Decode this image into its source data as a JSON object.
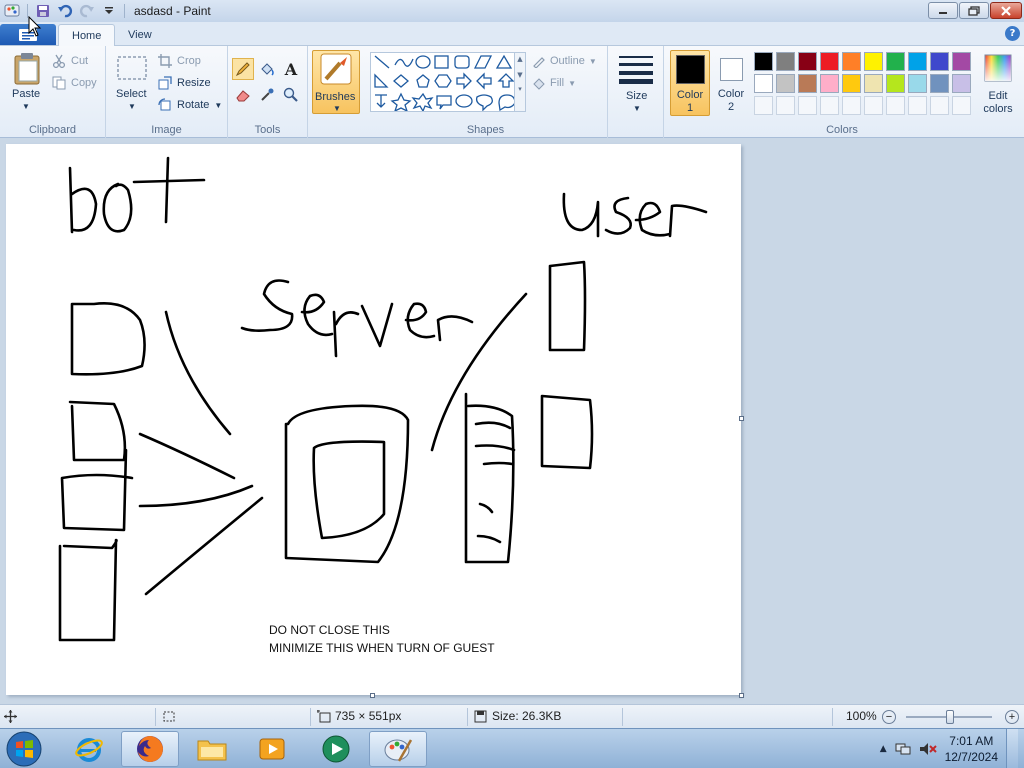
{
  "window": {
    "title": "asdasd - Paint"
  },
  "tabs": [
    {
      "label": "Home"
    },
    {
      "label": "View"
    }
  ],
  "ribbon": {
    "clipboard": {
      "group_label": "Clipboard",
      "paste": "Paste",
      "cut": "Cut",
      "copy": "Copy"
    },
    "image": {
      "group_label": "Image",
      "select": "Select",
      "crop": "Crop",
      "resize": "Resize",
      "rotate": "Rotate"
    },
    "tools": {
      "group_label": "Tools"
    },
    "brushes": {
      "label": "Brushes"
    },
    "shapes": {
      "group_label": "Shapes",
      "outline": "Outline",
      "fill": "Fill"
    },
    "size": {
      "label": "Size"
    },
    "color1": {
      "label_line1": "Color",
      "label_line2": "1"
    },
    "color2": {
      "label_line1": "Color",
      "label_line2": "2"
    },
    "colors": {
      "group_label": "Colors",
      "edit_line1": "Edit",
      "edit_line2": "colors",
      "palette_row1": [
        "#000000",
        "#7f7f7f",
        "#880015",
        "#ed1c24",
        "#ff7f27",
        "#fff200",
        "#22b14c",
        "#00a2e8",
        "#3f48cc",
        "#a349a4"
      ],
      "palette_row2": [
        "#ffffff",
        "#c3c3c3",
        "#b97a57",
        "#ffaec9",
        "#ffc90e",
        "#efe4b0",
        "#b5e61d",
        "#99d9ea",
        "#7092be",
        "#c8bfe7"
      ]
    }
  },
  "canvas": {
    "note_line1": "DO NOT CLOSE THIS",
    "note_line2": "MINIMIZE THIS WHEN TURN OF GUEST"
  },
  "statusbar": {
    "dimensions": "735 × 551px",
    "size": "Size: 26.3KB",
    "zoom": "100%"
  },
  "taskbar": {
    "time": "7:01 AM",
    "date": "12/7/2024"
  },
  "colors": {
    "accent": "#1d59b3",
    "active_tool": "#f7c35f"
  }
}
